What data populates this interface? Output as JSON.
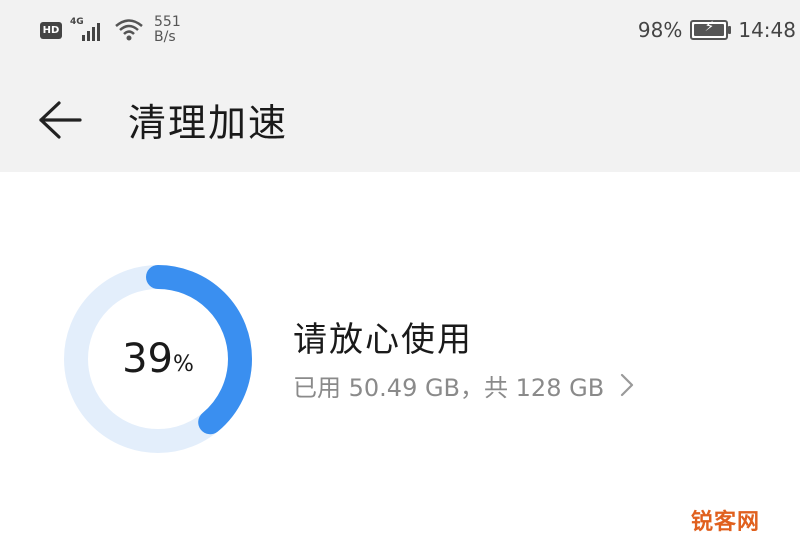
{
  "status_bar": {
    "hd_label": "HD",
    "signal_label": "4G",
    "net_speed_value": "551",
    "net_speed_unit": "B/s",
    "battery_percent": "98%",
    "time": "14:48"
  },
  "header": {
    "title": "清理加速",
    "back_icon": "back-arrow-icon"
  },
  "storage": {
    "percent_value": "39",
    "percent_sign": "%",
    "usage_fraction": 0.39,
    "status_text": "请放心使用",
    "detail_text": "已用 50.49 GB，共 128 GB",
    "ring_color": "#3a8ff0",
    "ring_track_color": "#e3eefb"
  },
  "watermark": "锐客网"
}
